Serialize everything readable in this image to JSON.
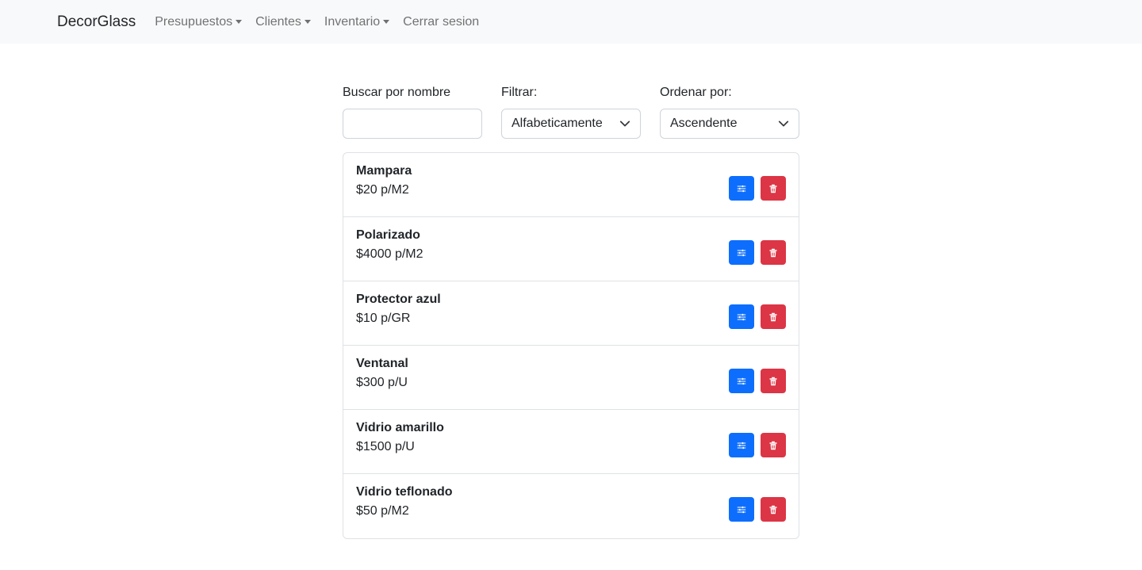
{
  "navbar": {
    "brand": "DecorGlass",
    "items": [
      {
        "label": "Presupuestos",
        "dropdown": true
      },
      {
        "label": "Clientes",
        "dropdown": true
      },
      {
        "label": "Inventario",
        "dropdown": true
      },
      {
        "label": "Cerrar sesion",
        "dropdown": false
      }
    ]
  },
  "filters": {
    "search_label": "Buscar por nombre",
    "search_value": "",
    "filter_label": "Filtrar:",
    "filter_value": "Alfabeticamente",
    "order_label": "Ordenar por:",
    "order_value": "Ascendente"
  },
  "items": [
    {
      "name": "Mampara",
      "price": "$20 p/M2"
    },
    {
      "name": "Polarizado",
      "price": "$4000 p/M2"
    },
    {
      "name": "Protector azul",
      "price": "$10 p/GR"
    },
    {
      "name": "Ventanal",
      "price": "$300 p/U"
    },
    {
      "name": "Vidrio amarillo",
      "price": "$1500 p/U"
    },
    {
      "name": "Vidrio teflonado",
      "price": "$50 p/M2"
    }
  ],
  "colors": {
    "edit": "#0d6efd",
    "delete": "#dc3545",
    "navbar_bg": "#f8f9fa"
  },
  "icons": {
    "edit": "sliders-icon",
    "delete": "trash-icon",
    "select": "chevron-down-icon",
    "dropdown": "caret-down-icon"
  }
}
